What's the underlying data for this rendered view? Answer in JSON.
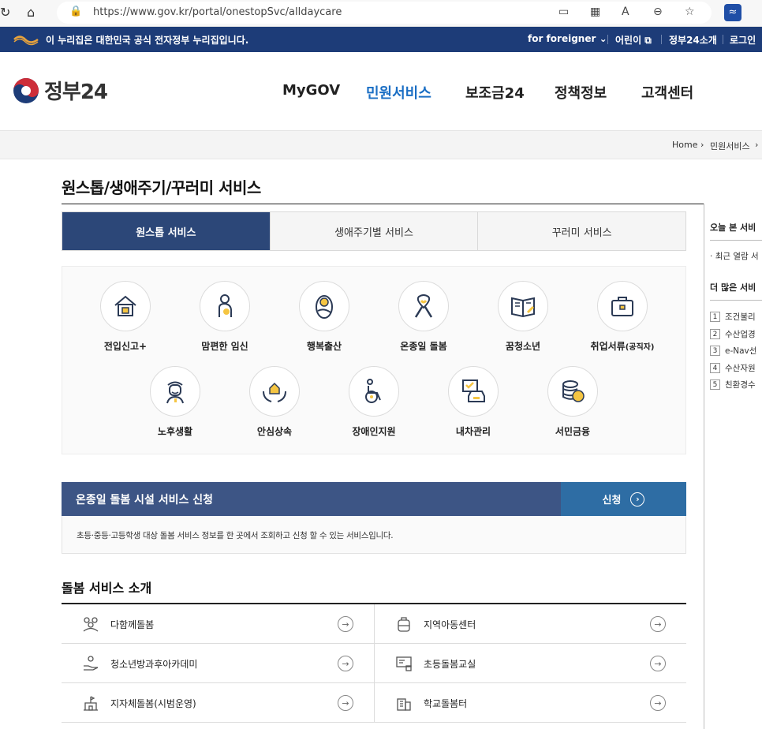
{
  "browser": {
    "url": "https://www.gov.kr/portal/onestopSvc/alldaycare"
  },
  "banner": {
    "text": "이 누리집은 대한민국 공식 전자정부 누리집입니다.",
    "foreigner": "for foreigner",
    "kids": "어린이",
    "about": "정부24소개",
    "login": "로그인"
  },
  "header": {
    "brand": "정부24",
    "nav": [
      "MyGOV",
      "민원서비스",
      "보조금24",
      "정책정보",
      "고객센터"
    ],
    "active_nav": "민원서비스"
  },
  "breadcrumb": {
    "home": "Home",
    "level1": "민원서비스"
  },
  "page": {
    "title": "원스톱/생애주기/꾸러미 서비스"
  },
  "tabs": [
    "원스톱 서비스",
    "생애주기별 서비스",
    "꾸러미 서비스"
  ],
  "services_row1": [
    {
      "label": "전입신고+",
      "icon": "house-icon"
    },
    {
      "label": "맘편한 임신",
      "icon": "pregnancy-icon"
    },
    {
      "label": "행복출산",
      "icon": "baby-icon"
    },
    {
      "label": "온종일 돌봄",
      "icon": "ribbon-icon"
    },
    {
      "label": "꿈청소년",
      "icon": "book-icon"
    },
    {
      "label": "취업서류",
      "label_small": "(공직자)",
      "icon": "briefcase-icon"
    }
  ],
  "services_row2": [
    {
      "label": "노후생활",
      "icon": "elder-icon"
    },
    {
      "label": "안심상속",
      "icon": "hands-house-icon"
    },
    {
      "label": "장애인지원",
      "icon": "wheelchair-icon"
    },
    {
      "label": "내차관리",
      "icon": "car-icon"
    },
    {
      "label": "서민금융",
      "icon": "coins-icon"
    }
  ],
  "apply": {
    "title": "온종일 돌봄 시설 서비스 신청",
    "button": "신청",
    "desc": "초등·중등·고등학생 대상 돌봄 서비스 정보를 한 곳에서 조회하고 신청 할 수 있는 서비스입니다."
  },
  "care": {
    "title": "돌봄 서비스 소개",
    "items": [
      {
        "label": "다함께돌봄",
        "icon": "people-icon"
      },
      {
        "label": "지역아동센터",
        "icon": "backpack-icon"
      },
      {
        "label": "청소년방과후아카데미",
        "icon": "hand-icon"
      },
      {
        "label": "초등돌봄교실",
        "icon": "classroom-icon"
      },
      {
        "label": "지자체돌봄(시범운영)",
        "icon": "town-hall-icon"
      },
      {
        "label": "학교돌봄터",
        "icon": "building-icon"
      }
    ]
  },
  "sidebar": {
    "today": "오늘 본 서비",
    "recent": "최근 열람 서",
    "more": "더 많은 서비",
    "list": [
      "조건불리",
      "수산업경",
      "e-Nav선",
      "수산자원",
      "친환경수"
    ]
  }
}
